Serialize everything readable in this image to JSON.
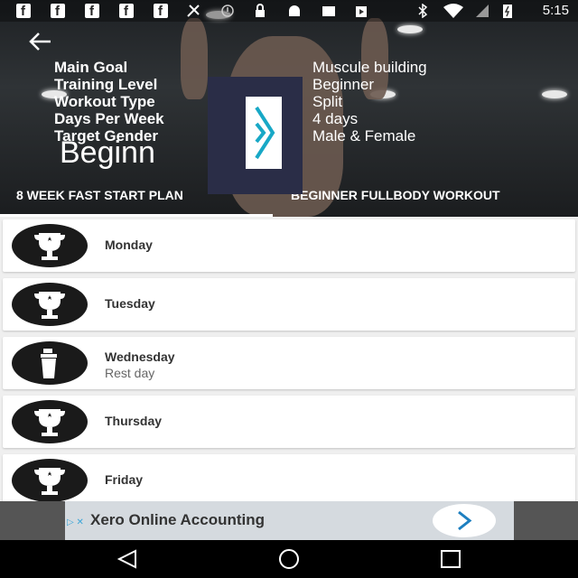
{
  "status_bar": {
    "time": "5:15"
  },
  "hero": {
    "details": [
      {
        "label": "Main Goal",
        "value": "Muscule building"
      },
      {
        "label": "Training Level",
        "value": "Beginner"
      },
      {
        "label": "Workout Type",
        "value": "Split"
      },
      {
        "label": "Days Per Week",
        "value": "4 days"
      },
      {
        "label": "Target Gender",
        "value": "Male & Female"
      }
    ],
    "title": "Beginn",
    "tabs": [
      {
        "label": "8 WEEK FAST START PLAN"
      },
      {
        "label": "BEGINNER FULLBODY WORKOUT"
      }
    ]
  },
  "days": [
    {
      "name": "Monday",
      "icon": "trophy-icon"
    },
    {
      "name": "Tuesday",
      "icon": "trophy-icon"
    },
    {
      "name": "Wednesday",
      "subtitle": "Rest day",
      "icon": "shaker-bottle-icon"
    },
    {
      "name": "Thursday",
      "icon": "trophy-icon"
    },
    {
      "name": "Friday",
      "icon": "trophy-icon"
    }
  ],
  "ad": {
    "text": "Xero Online Accounting",
    "badge": "▷ ✕"
  },
  "colors": {
    "hero_bg": "#2f3336",
    "card_bg": "#ffffff",
    "avatar": "#1a1a1a",
    "ad_bg": "#d5dadf"
  }
}
